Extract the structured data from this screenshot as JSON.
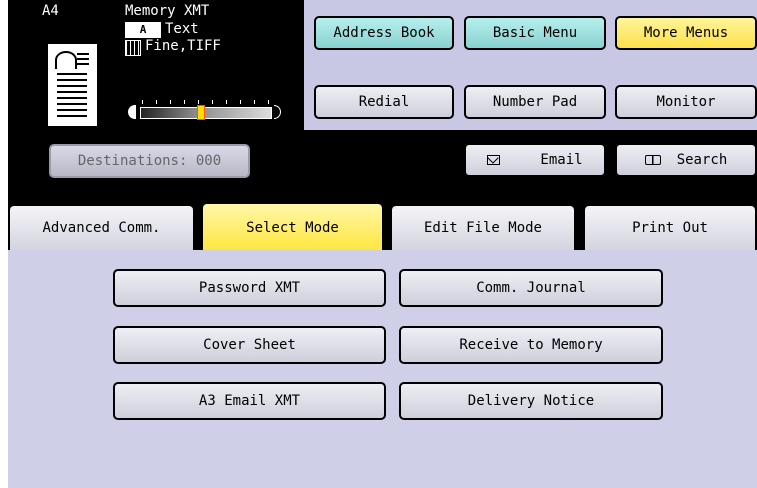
{
  "status": {
    "paper_size": "A4",
    "mode": "Memory XMT",
    "original_type": "Text",
    "resolution": "Fine,TIFF",
    "destinations_button": "Destinations: 000"
  },
  "top_buttons": {
    "address_book": "Address Book",
    "basic_menu": "Basic Menu",
    "more_menus": "More Menus",
    "redial": "Redial",
    "number_pad": "Number Pad",
    "monitor": "Monitor",
    "email": "Email",
    "search": "Search"
  },
  "tabs": [
    {
      "label": "Advanced Comm.",
      "active": false
    },
    {
      "label": "Select Mode",
      "active": true
    },
    {
      "label": "Edit File Mode",
      "active": false
    },
    {
      "label": "Print Out",
      "active": false
    }
  ],
  "mode_buttons": [
    "Password XMT",
    "Comm. Journal",
    "Cover Sheet",
    "Receive to Memory",
    "A3 Email XMT",
    "Delivery Notice"
  ],
  "contrast_level": 0.5,
  "colors": {
    "teal": "#88d2d0",
    "yellow": "#fde04a",
    "lavender": "#c8c8e4"
  }
}
